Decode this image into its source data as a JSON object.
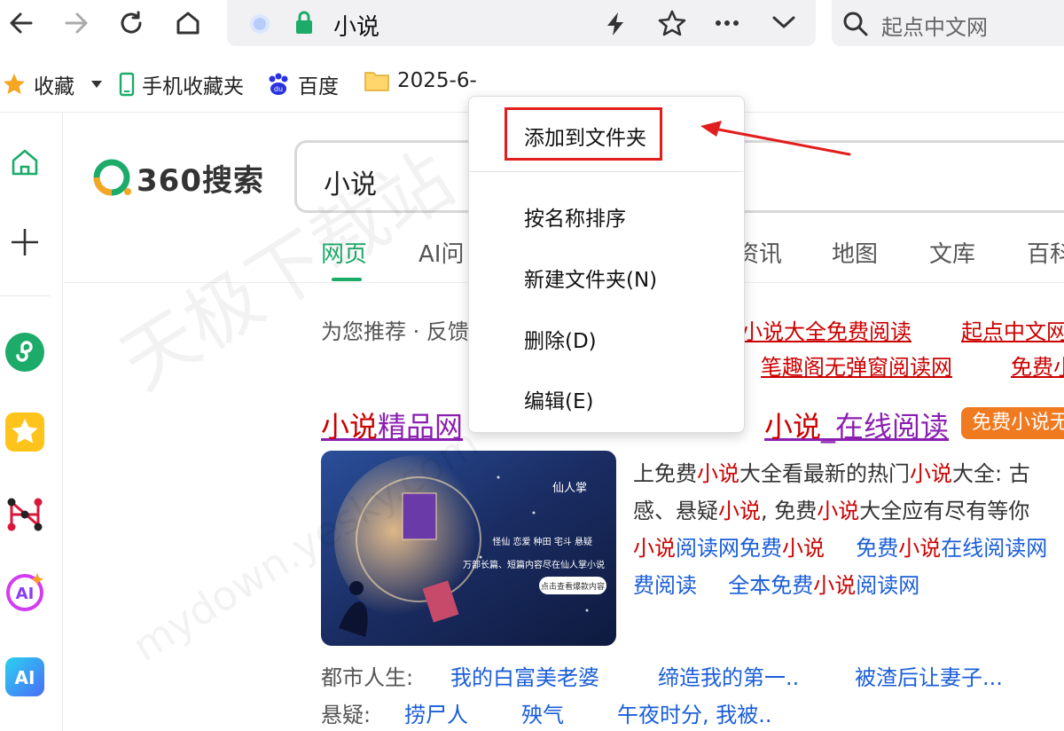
{
  "toolbar": {
    "address_text": "小说",
    "search_placeholder": "起点中文网",
    "icons": [
      "back-icon",
      "forward-icon",
      "refresh-icon",
      "home-icon",
      "shield-icon",
      "lock-icon",
      "flash-icon",
      "star-icon",
      "more-icon",
      "chevron-down-icon",
      "search-icon"
    ]
  },
  "bookmarks": {
    "items": [
      "收藏",
      "手机收藏夹",
      "百度",
      "2025-6-"
    ]
  },
  "page": {
    "logo_text": "360搜索",
    "query": "小说",
    "tabs": [
      "网页",
      "AI问",
      "资讯",
      "地图",
      "文库",
      "百科"
    ],
    "recommend_label": "为您推荐 · 反馈",
    "recommend_links": [
      "小说大全免费阅读",
      "起点中文网",
      "笔趣阁无弹窗阅读网",
      "免费小说"
    ],
    "result": {
      "title_prefix": "小说",
      "title_mid": "精品网",
      "title_suffix_hl": "小说",
      "title_end": "_在线阅读",
      "badge": "免费小说无",
      "snippet_line1_a": "上免费",
      "snippet_line1_b": "小说",
      "snippet_line1_c": "大全看最新的热门",
      "snippet_line1_d": "小说",
      "snippet_line1_e": "大全: 古",
      "snippet_line2_a": "感、悬疑",
      "snippet_line2_b": "小说",
      "snippet_line2_c": ", 免费",
      "snippet_line2_d": "小说",
      "snippet_line2_e": "大全应有尽有等你",
      "link_row1_a1": "小说",
      "link_row1_a2": "阅读网免费",
      "link_row1_a3": "小说",
      "link_row1_b1": "免费",
      "link_row1_b2": "小说",
      "link_row1_b3": "在线阅读网",
      "link_row2_a": "费阅读",
      "link_row2_b1": "全本免费",
      "link_row2_b2": "小说",
      "link_row2_b3": "阅读网"
    },
    "categories": [
      {
        "label": "都市人生:",
        "links": [
          "我的白富美老婆",
          "缔造我的第一..",
          "被渣后让妻子..."
        ]
      },
      {
        "label": "悬疑:",
        "links": [
          "捞尸人",
          "殃气",
          "午夜时分, 我被.."
        ]
      }
    ],
    "thumb_text": {
      "brand": "仙人掌",
      "tags": "怪仙  恋爱  种田  宅斗  悬疑",
      "promo": "万部长篇、短篇内容尽在仙人掌小说",
      "button": "点击查看爆款内容"
    },
    "watermark": "天极下载站",
    "watermark2": "mydown.yesky.com"
  },
  "menu": {
    "items": [
      "添加到文件夹",
      "按名称排序",
      "新建文件夹(N)",
      "删除(D)",
      "编辑(E)"
    ]
  },
  "colors": {
    "accent_green": "#1dab6a",
    "link_red": "#cc0000",
    "link_blue": "#1a5ed8",
    "visited_purple": "#8b1fb1",
    "badge_orange": "#f07a20",
    "highlight_red": "#e11d1d"
  }
}
